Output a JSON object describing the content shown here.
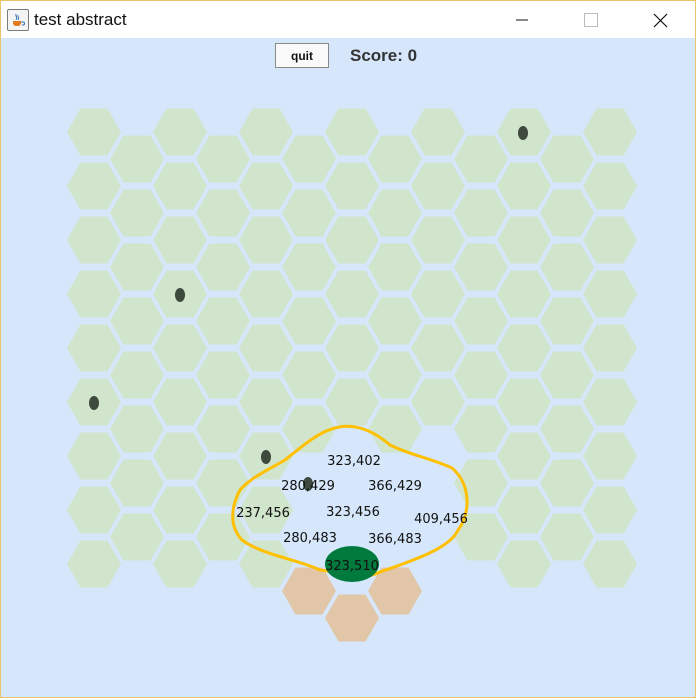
{
  "window": {
    "title": "test abstract",
    "icon": "java-cup-icon"
  },
  "toolbar": {
    "quit_label": "quit",
    "score_label": "Score: 0"
  },
  "colors": {
    "background": "#d6e7fb",
    "hex_fill": "#d0e5cc",
    "hex_path": "#e2c6a8",
    "player": "#007a3d",
    "obstacle": "#3e4a3e",
    "range_outline": "#ffc000"
  },
  "board": {
    "cells": [
      {
        "label": "323,402"
      },
      {
        "label": "280,429"
      },
      {
        "label": "366,429"
      },
      {
        "label": "237,456"
      },
      {
        "label": "323,456"
      },
      {
        "label": "409,456"
      },
      {
        "label": "280,483"
      },
      {
        "label": "366,483"
      },
      {
        "label": "323,510"
      }
    ]
  }
}
